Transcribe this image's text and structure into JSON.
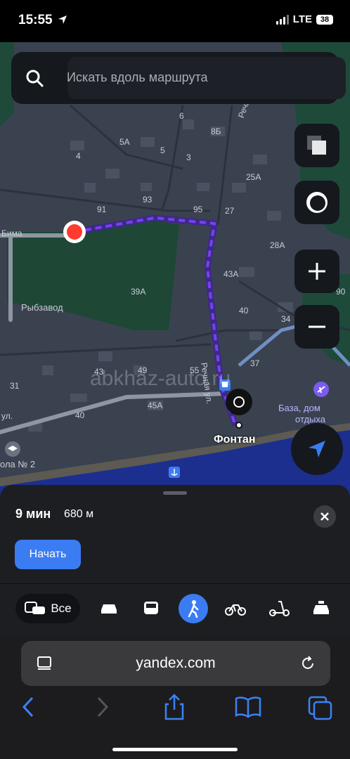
{
  "status": {
    "time": "15:55",
    "network": "LTE",
    "battery": "38"
  },
  "search": {
    "placeholder": "Искать вдоль маршрута"
  },
  "map": {
    "labels": [
      "5А",
      "6",
      "8Б",
      "4",
      "5",
      "3",
      "25А",
      "93",
      "95",
      "27",
      "91",
      "28А",
      "43А",
      "39А",
      "Рыбзавод",
      "40",
      "34",
      "37",
      "43",
      "49",
      "55",
      "45А",
      "31",
      "40",
      "Речная ул.",
      "Речная ул.",
      "Бима",
      "ул.",
      "ола № 2",
      "База, дом",
      "отдыха",
      "90"
    ],
    "destination_label": "Фонтан",
    "watermark": "abkhaz-auto.ru"
  },
  "route": {
    "duration": "9 мин",
    "distance": "680 м",
    "start_label": "Начать"
  },
  "modes": {
    "all_label": "Все",
    "items": [
      "bus-car-all",
      "car",
      "bus",
      "walk",
      "bike",
      "scooter",
      "taxi"
    ],
    "active": "walk"
  },
  "browser": {
    "url": "yandex.com"
  },
  "colors": {
    "accent": "#3b7cf2",
    "route": "#7a3ff0",
    "start_point": "#ff3b30"
  }
}
